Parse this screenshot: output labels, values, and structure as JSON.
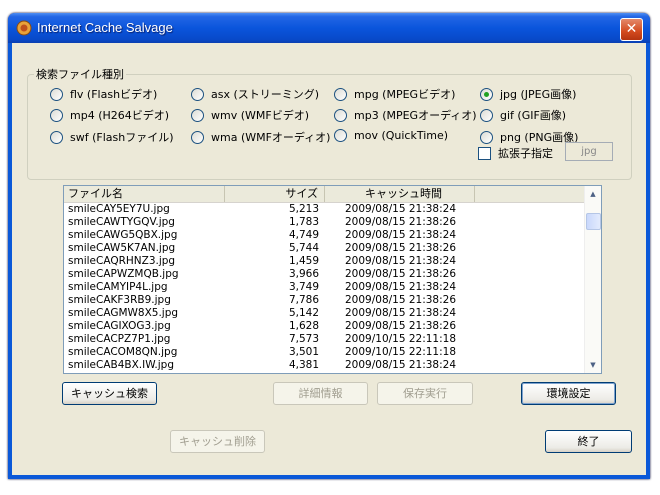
{
  "window": {
    "title": "Internet Cache Salvage",
    "close_glyph": "✕"
  },
  "filetypes": {
    "legend": "検索ファイル種別",
    "options": [
      {
        "label": "flv (Flashビデオ)",
        "checked": false
      },
      {
        "label": "mp4 (H264ビデオ)",
        "checked": false
      },
      {
        "label": "swf (Flashファイル)",
        "checked": false
      },
      {
        "label": "asx (ストリーミング)",
        "checked": false
      },
      {
        "label": "wmv (WMFビデオ)",
        "checked": false
      },
      {
        "label": "wma (WMFオーディオ)",
        "checked": false
      },
      {
        "label": "mpg (MPEGビデオ)",
        "checked": false
      },
      {
        "label": "mp3 (MPEGオーディオ)",
        "checked": false
      },
      {
        "label": "mov (QuickTime)",
        "checked": false
      },
      {
        "label": "jpg (JPEG画像)",
        "checked": true
      },
      {
        "label": "gif (GIF画像)",
        "checked": false
      },
      {
        "label": "png (PNG画像)",
        "checked": false
      }
    ],
    "ext_check_label": "拡張子指定",
    "ext_value": "jpg"
  },
  "table": {
    "headers": {
      "name": "ファイル名",
      "size": "サイズ",
      "time": "キャッシュ時間"
    },
    "rows": [
      {
        "name": "smileCAY5EY7U.jpg",
        "size": "5,213",
        "time": "2009/08/15 21:38:24"
      },
      {
        "name": "smileCAWTYGQV.jpg",
        "size": "1,783",
        "time": "2009/08/15 21:38:26"
      },
      {
        "name": "smileCAWG5QBX.jpg",
        "size": "4,749",
        "time": "2009/08/15 21:38:24"
      },
      {
        "name": "smileCAW5K7AN.jpg",
        "size": "5,744",
        "time": "2009/08/15 21:38:26"
      },
      {
        "name": "smileCAQRHNZ3.jpg",
        "size": "1,459",
        "time": "2009/08/15 21:38:24"
      },
      {
        "name": "smileCAPWZMQB.jpg",
        "size": "3,966",
        "time": "2009/08/15 21:38:26"
      },
      {
        "name": "smileCAMYIP4L.jpg",
        "size": "3,749",
        "time": "2009/08/15 21:38:24"
      },
      {
        "name": "smileCAKF3RB9.jpg",
        "size": "7,786",
        "time": "2009/08/15 21:38:26"
      },
      {
        "name": "smileCAGMW8X5.jpg",
        "size": "5,142",
        "time": "2009/08/15 21:38:24"
      },
      {
        "name": "smileCAGIXOG3.jpg",
        "size": "1,628",
        "time": "2009/08/15 21:38:26"
      },
      {
        "name": "smileCACPZ7P1.jpg",
        "size": "7,573",
        "time": "2009/10/15 22:11:18"
      },
      {
        "name": "smileCACOM8QN.jpg",
        "size": "3,501",
        "time": "2009/10/15 22:11:18"
      },
      {
        "name": "smileCAB4BX.IW.jpg",
        "size": "4,381",
        "time": "2009/08/15 21:38:24"
      }
    ]
  },
  "buttons": {
    "search": "キャッシュ検索",
    "details": "詳細情報",
    "save": "保存実行",
    "settings": "環境設定",
    "delete": "キャッシュ削除",
    "exit": "終了"
  }
}
